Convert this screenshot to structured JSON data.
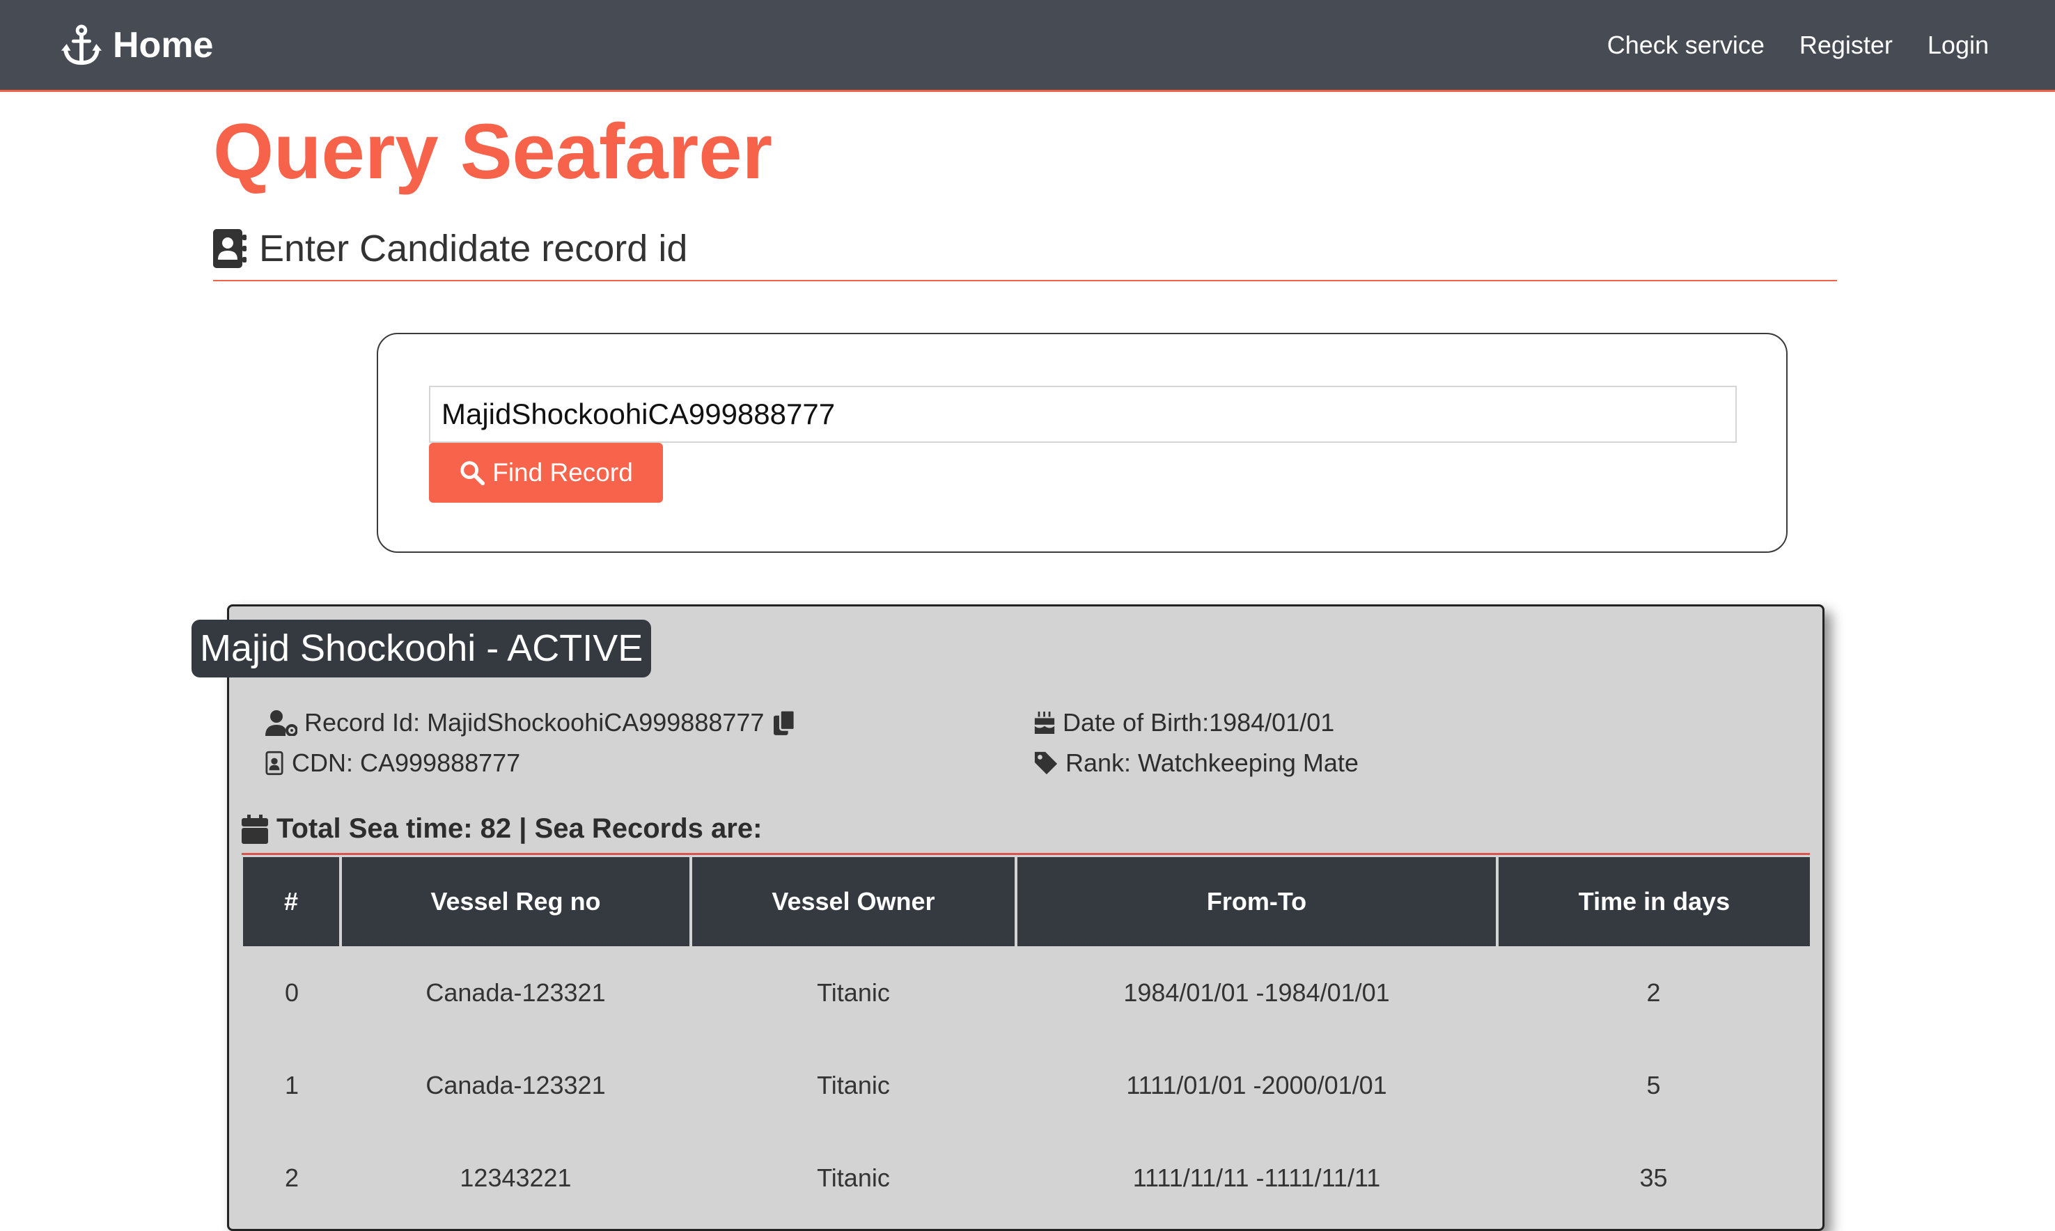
{
  "navbar": {
    "brand_label": "Home",
    "brand_icon": "anchor-icon",
    "links": [
      "Check service",
      "Register",
      "Login"
    ],
    "background": "#474b53",
    "accent": "#f0614a"
  },
  "page": {
    "title": "Query Seafarer",
    "section_heading": "Enter Candidate record id",
    "accent": "#f6634a"
  },
  "search": {
    "value": "MajidShockoohiCA999888777",
    "button_label": "Find Record"
  },
  "record": {
    "name_status": "Majid Shockoohi - ACTIVE",
    "record_id": "Record Id: MajidShockoohiCA999888777",
    "cdn": "CDN: CA999888777",
    "date_of_birth": "Date of Birth:1984/01/01",
    "rank": "Rank: Watchkeeping Mate",
    "total_sea_time": "Total Sea time: 82 | Sea Records are:"
  },
  "table": {
    "headers": [
      "#",
      "Vessel Reg no",
      "Vessel Owner",
      "From-To",
      "Time in days"
    ],
    "rows": [
      [
        "0",
        "Canada-123321",
        "Titanic",
        "1984/01/01 -1984/01/01",
        "2"
      ],
      [
        "1",
        "Canada-123321",
        "Titanic",
        "1111/01/01 -2000/01/01",
        "5"
      ],
      [
        "2",
        "12343221",
        "Titanic",
        "1111/11/11 -1111/11/11",
        "35"
      ]
    ]
  }
}
